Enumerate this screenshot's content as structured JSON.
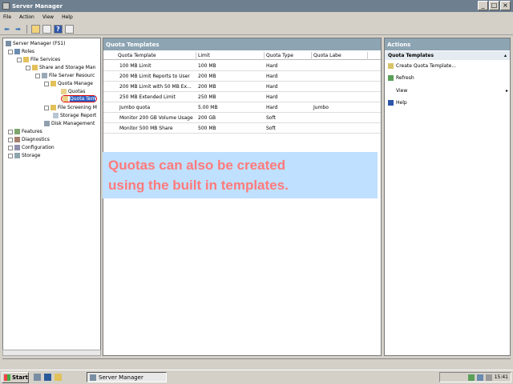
{
  "window": {
    "title": "Server Manager"
  },
  "menu": [
    "File",
    "Action",
    "View",
    "Help"
  ],
  "tree": [
    {
      "label": "Server Manager (FS1)",
      "depth": 0
    },
    {
      "label": "Roles",
      "depth": 1
    },
    {
      "label": "File Services",
      "depth": 2
    },
    {
      "label": "Share and Storage Man",
      "depth": 3
    },
    {
      "label": "File Server Resourc",
      "depth": 4
    },
    {
      "label": "Quota Manage",
      "depth": 5
    },
    {
      "label": "Quotas",
      "depth": 6
    },
    {
      "label": "Quota Tem",
      "depth": 6
    },
    {
      "label": "File Screening M",
      "depth": 5
    },
    {
      "label": "Storage Report",
      "depth": 5
    },
    {
      "label": "Disk Management",
      "depth": 4
    },
    {
      "label": "Features",
      "depth": 0
    },
    {
      "label": "Diagnostics",
      "depth": 0
    },
    {
      "label": "Configuration",
      "depth": 0
    },
    {
      "label": "Storage",
      "depth": 0
    }
  ],
  "center": {
    "title": "Quota Templates",
    "columns": [
      "Quota Template",
      "Limit",
      "Quota Type",
      "Quota Labe"
    ],
    "rows": [
      [
        "100 MB Limit",
        "100 MB",
        "Hard",
        ""
      ],
      [
        "200 MB Limit Reports to User",
        "200 MB",
        "Hard",
        ""
      ],
      [
        "200 MB Limit with 50 MB Ex...",
        "200 MB",
        "Hard",
        ""
      ],
      [
        "250 MB Extended Limit",
        "250 MB",
        "Hard",
        ""
      ],
      [
        "Jumbo quota",
        "5.00 MB",
        "Hard",
        "Jumbo"
      ],
      [
        "Monitor 200 GB Volume Usage",
        "200 GB",
        "Soft",
        ""
      ],
      [
        "Monitor 500 MB Share",
        "500 MB",
        "Soft",
        ""
      ]
    ]
  },
  "overlay": {
    "line1": "Quotas can also be created",
    "line2": "using the built in templates."
  },
  "actions": {
    "title": "Actions",
    "section": "Quota Templates",
    "items": [
      "Create Quota Template...",
      "Refresh",
      "View",
      "Help"
    ]
  },
  "taskbar": {
    "start": "Start",
    "item": "Server Manager",
    "clock": "15:41"
  }
}
